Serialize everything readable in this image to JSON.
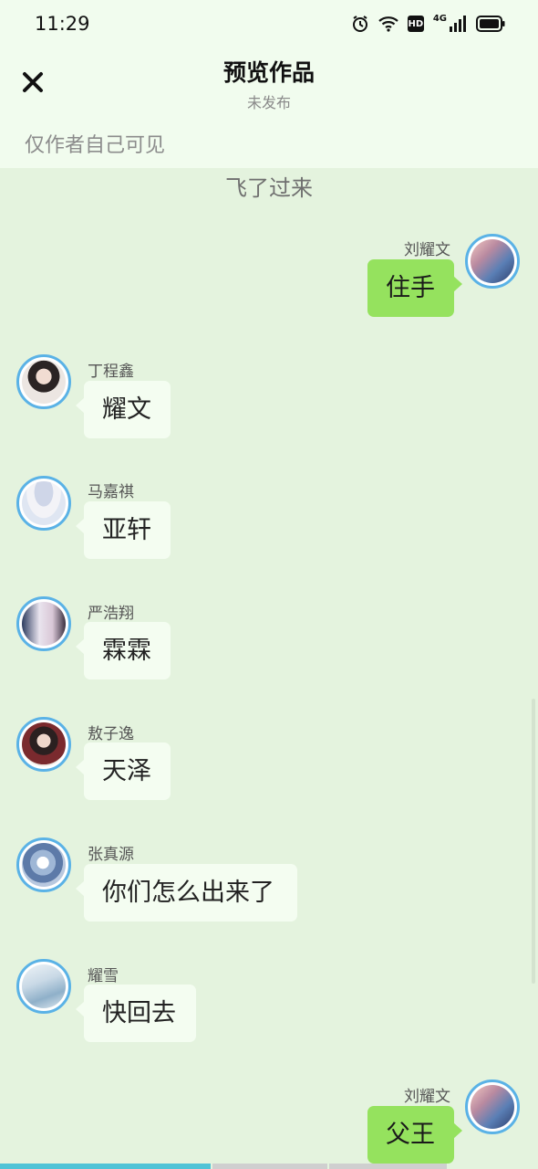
{
  "status_bar": {
    "time": "11:29",
    "icons": [
      "alarm-icon",
      "wifi-icon",
      "hd-badge",
      "4g-icon",
      "signal-icon",
      "battery-icon"
    ],
    "hd_label": "HD",
    "network_label": "4G"
  },
  "header": {
    "close_icon": "close-icon",
    "title": "预览作品",
    "subtitle": "未发布",
    "visibility_note": "仅作者自己可见"
  },
  "chat": {
    "narration": "飞了过来",
    "messages": [
      {
        "sender": "刘耀文",
        "text": "住手",
        "side": "right"
      },
      {
        "sender": "丁程鑫",
        "text": "耀文",
        "side": "left"
      },
      {
        "sender": "马嘉祺",
        "text": "亚轩",
        "side": "left"
      },
      {
        "sender": "严浩翔",
        "text": "霖霖",
        "side": "left"
      },
      {
        "sender": "敖子逸",
        "text": "天泽",
        "side": "left"
      },
      {
        "sender": "张真源",
        "text": "你们怎么出来了",
        "side": "left"
      },
      {
        "sender": "耀雪",
        "text": "快回去",
        "side": "left"
      },
      {
        "sender": "刘耀文",
        "text": "父王",
        "side": "right"
      }
    ]
  },
  "colors": {
    "background": "#e4f3de",
    "header_background": "#f1fcee",
    "right_bubble": "#95e25e",
    "left_bubble": "#f4fdf1",
    "avatar_ring": "#5ab2e6",
    "progress_active": "#4fc3d6"
  }
}
